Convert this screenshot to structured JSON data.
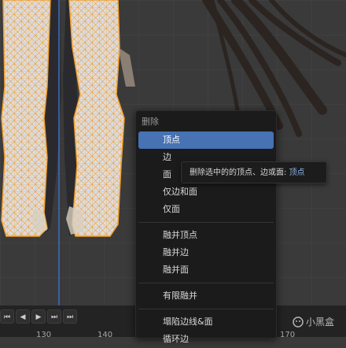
{
  "menu": {
    "title": "删除",
    "items": [
      "顶点",
      "边",
      "面",
      "仅边和面",
      "仅面"
    ],
    "merge_items": [
      "融并顶点",
      "融并边",
      "融并面"
    ],
    "limited_item": "有限融并",
    "other_items": [
      "塌陷边线&面",
      "循环边"
    ]
  },
  "tooltip": {
    "text": "删除选中的的顶点、边或面: ",
    "key": "顶点"
  },
  "timeline": {
    "ticks": [
      "130",
      "140",
      "170"
    ]
  },
  "watermark": "小黑盒",
  "colors": {
    "accent": "#4772b3",
    "mesh": "#f0a030"
  }
}
